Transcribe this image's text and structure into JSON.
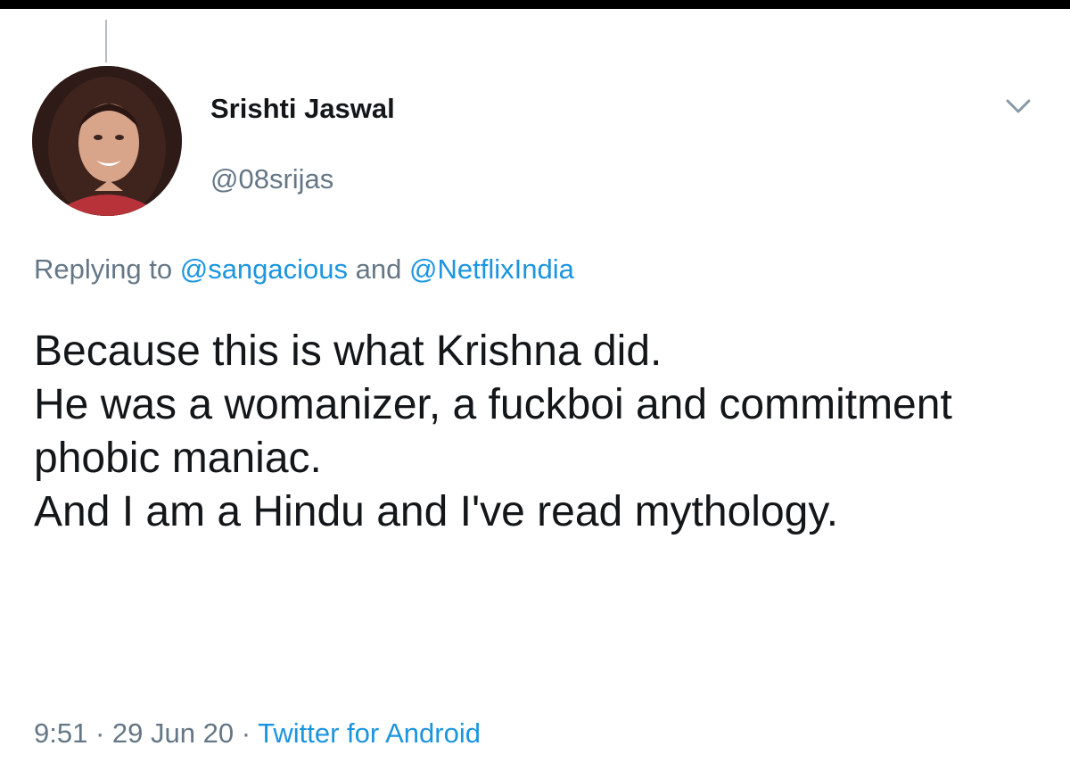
{
  "tweet": {
    "display_name": "Srishti Jaswal",
    "handle": "@08srijas",
    "replying_prefix": "Replying to",
    "replying_to": [
      "@sangacious",
      "@NetflixIndia"
    ],
    "replying_joiner": "and",
    "text": "Because this is what Krishna did.\nHe was a womanizer, a fuckboi and commitment phobic maniac.\nAnd I am a Hindu and I've read mythology.",
    "time": "9:51",
    "date": "29 Jun 20",
    "separator": "·",
    "source": "Twitter for Android"
  },
  "icons": {
    "caret": "chevron-down-icon",
    "avatar": "profile-photo"
  },
  "colors": {
    "text_primary": "#14171a",
    "text_secondary": "#657786",
    "link": "#1b95e0"
  }
}
